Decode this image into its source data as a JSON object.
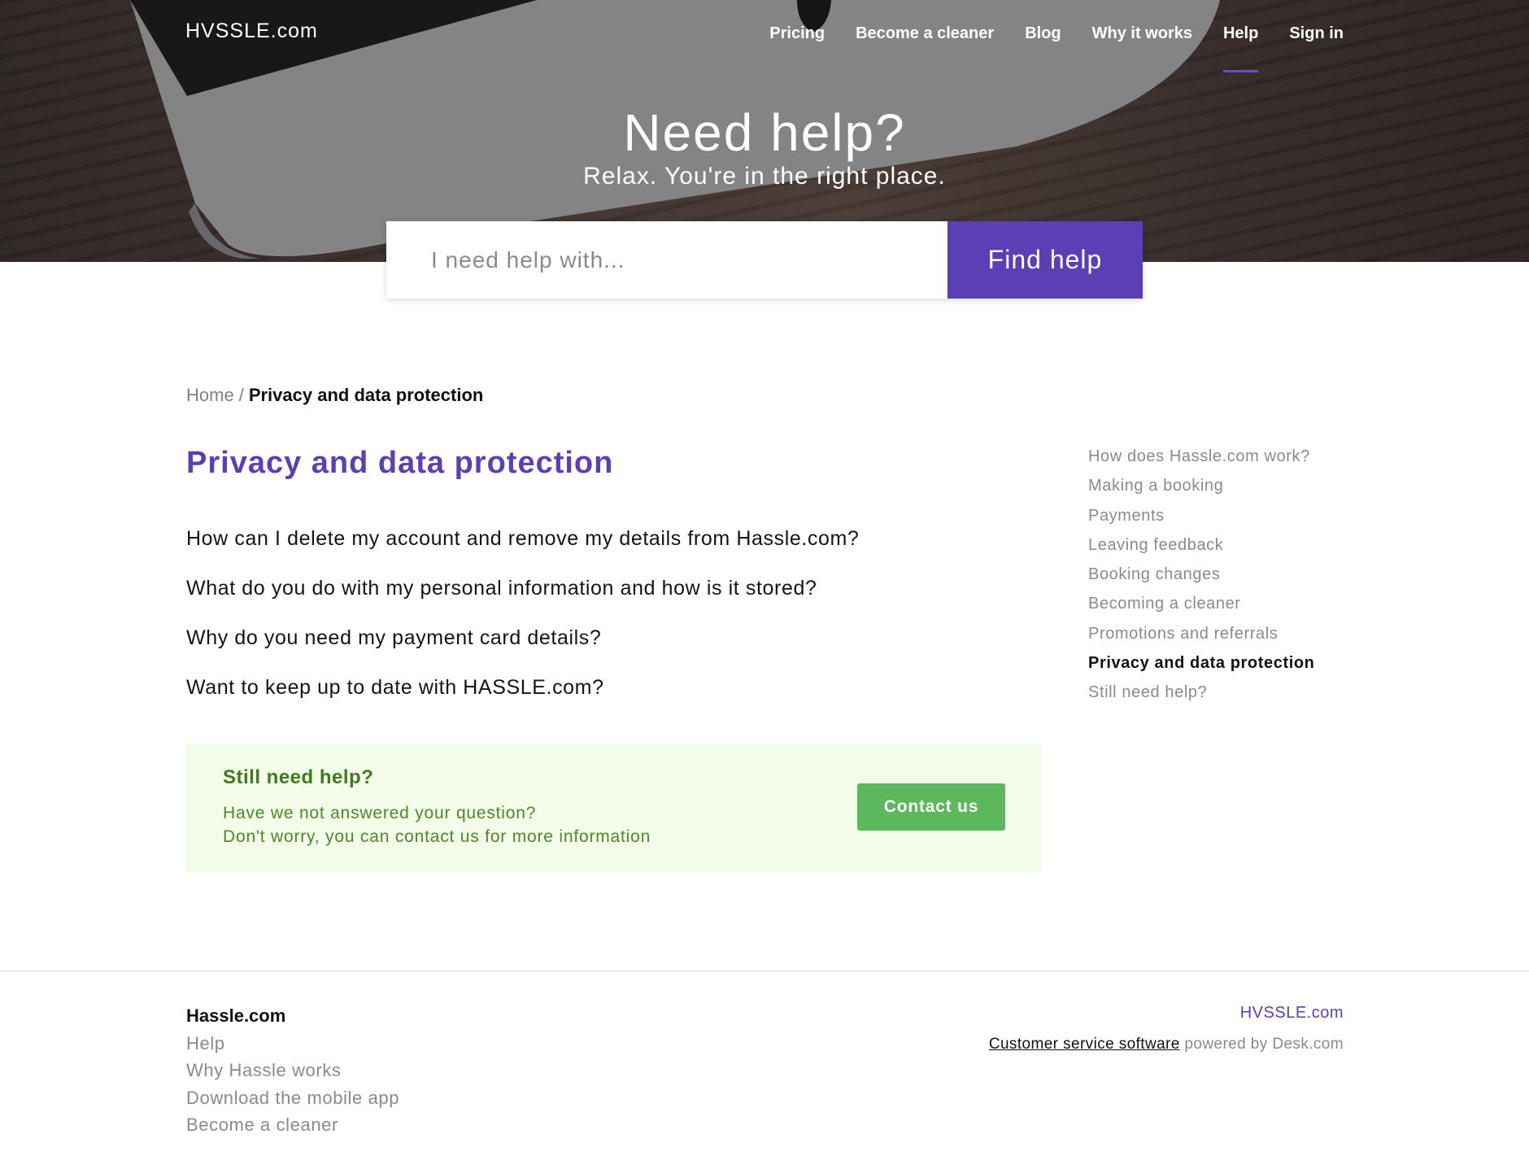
{
  "header": {
    "logo": "HVSSLE.com",
    "nav": [
      {
        "label": "Pricing"
      },
      {
        "label": "Become a cleaner"
      },
      {
        "label": "Blog"
      },
      {
        "label": "Why it works"
      },
      {
        "label": "Help",
        "active": true
      },
      {
        "label": "Sign in"
      }
    ]
  },
  "hero": {
    "title": "Need help?",
    "subtitle": "Relax. You're in the right place."
  },
  "search": {
    "placeholder": "I need help with...",
    "button_label": "Find help"
  },
  "breadcrumb": {
    "home": "Home",
    "separator": "/",
    "current": "Privacy and data protection"
  },
  "main": {
    "title": "Privacy and data protection",
    "articles": [
      "How can I delete my account and remove my details from Hassle.com?",
      "What do you do with my personal information and how is it stored?",
      "Why do you need my payment card details?",
      "Want to keep up to date with HASSLE.com?"
    ]
  },
  "help_box": {
    "title": "Still need help?",
    "line1": "Have we not answered your question?",
    "line2": "Don't worry, you can contact us for more information",
    "button_label": "Contact us"
  },
  "sidebar": {
    "items": [
      {
        "label": "How does Hassle.com work?"
      },
      {
        "label": "Making a booking"
      },
      {
        "label": "Payments"
      },
      {
        "label": "Leaving feedback"
      },
      {
        "label": "Booking changes"
      },
      {
        "label": "Becoming a cleaner"
      },
      {
        "label": "Promotions and referrals"
      },
      {
        "label": "Privacy and data protection",
        "active": true
      },
      {
        "label": "Still need help?"
      }
    ]
  },
  "footer": {
    "heading": "Hassle.com",
    "links": [
      "Help",
      "Why Hassle works",
      "Download the mobile app",
      "Become a cleaner"
    ],
    "brand": "HVSSLE.com",
    "powered_link": "Customer service software",
    "powered_text": " powered by Desk.com"
  },
  "colors": {
    "accent": "#5c3fb5",
    "success": "#5cb85c",
    "help_box_bg": "#f3fce9"
  }
}
